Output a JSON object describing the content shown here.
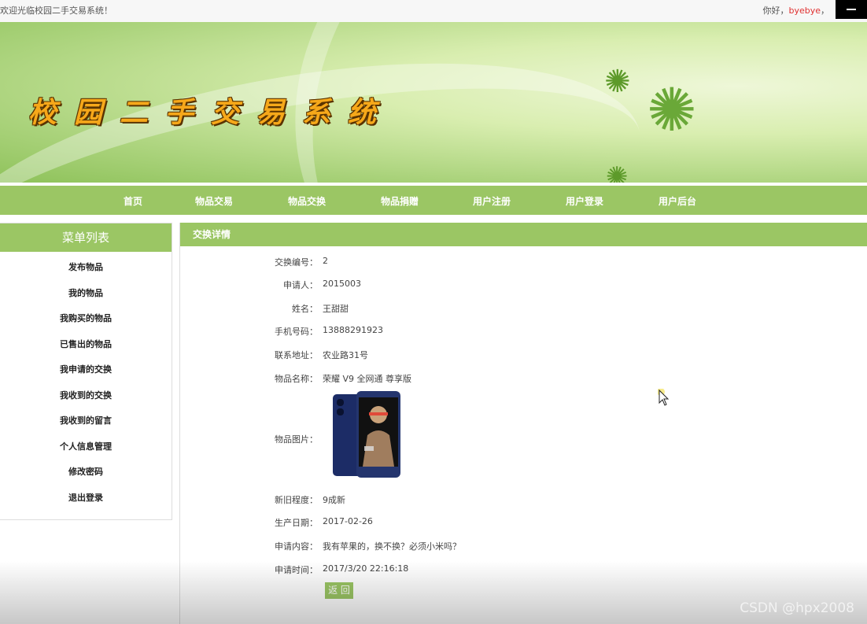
{
  "topbar": {
    "welcome": "欢迎光临校园二手交易系统！",
    "greeting_prefix": "你好，",
    "username": "byebye",
    "greeting_suffix": "，"
  },
  "banner": {
    "title": "校园二手交易系统"
  },
  "nav": {
    "items": [
      "首页",
      "物品交易",
      "物品交换",
      "物品捐赠",
      "用户注册",
      "用户登录",
      "用户后台"
    ]
  },
  "sidebar": {
    "title": "菜单列表",
    "items": [
      "发布物品",
      "我的物品",
      "我购买的物品",
      "已售出的物品",
      "我申请的交换",
      "我收到的交换",
      "我收到的留言",
      "个人信息管理",
      "修改密码",
      "退出登录"
    ]
  },
  "detail": {
    "title": "交换详情",
    "fields": {
      "exchange_no_label": "交换编号：",
      "exchange_no": "2",
      "applicant_label": "申请人：",
      "applicant": "2015003",
      "name_label": "姓名：",
      "name": "王甜甜",
      "phone_label": "手机号码：",
      "phone": "13888291923",
      "address_label": "联系地址：",
      "address": "农业路31号",
      "item_name_label": "物品名称：",
      "item_name": "荣耀 V9 全网通 尊享版",
      "item_image_label": "物品图片：",
      "condition_label": "新旧程度：",
      "condition": "9成新",
      "production_date_label": "生产日期：",
      "production_date": "2017-02-26",
      "request_content_label": "申请内容：",
      "request_content": "我有苹果的，换不换？必须小米吗？",
      "request_time_label": "申请时间：",
      "request_time": "2017/3/20 22:16:18"
    },
    "back_label": "返 回"
  },
  "watermark": "CSDN @hpx2008",
  "colors": {
    "accent": "#9bc664",
    "username": "#e03030",
    "title": "#f6a81a"
  }
}
